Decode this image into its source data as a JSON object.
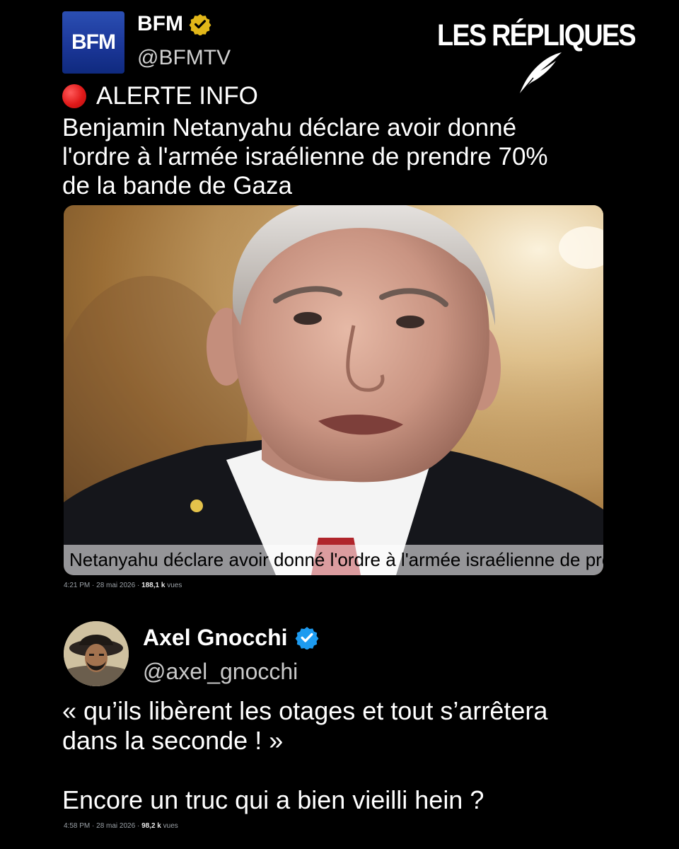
{
  "brand": {
    "title": "LES RÉPLIQUES",
    "icon": "quill-icon"
  },
  "tweet1": {
    "logo_text": "BFM",
    "name": "BFM",
    "handle": "@BFMTV",
    "badge": "gold-verified-icon",
    "alert": "ALERTE INFO",
    "text_lines": [
      "Benjamin Netanyahu déclare avoir donné",
      "l'ordre à l'armée israélienne de prendre 70%",
      "de la bande de Gaza"
    ],
    "image_caption": "Netanyahu déclare avoir donné l'ordre à l'armée israélienne de prendre",
    "time": "4:21 PM · 28 mai 2026 · ",
    "views": "188,1 k",
    "views_label": " vues"
  },
  "tweet2": {
    "name": "Axel Gnocchi",
    "handle": "@axel_gnocchi",
    "badge": "blue-verified-icon",
    "text_lines": [
      "« qu’ils libèrent les otages et tout s’arrêtera",
      "dans la seconde ! »",
      "",
      "Encore un truc qui a bien vieilli hein ?"
    ],
    "time": "4:58 PM · 28 mai 2026 · ",
    "views": "98,2 k",
    "views_label": " vues"
  },
  "colors": {
    "background": "#000000",
    "bfm_blue": "#1a3596",
    "verified_blue": "#1d9bf0",
    "gold_badge": "#e2b719",
    "alert_red": "#e01919"
  }
}
